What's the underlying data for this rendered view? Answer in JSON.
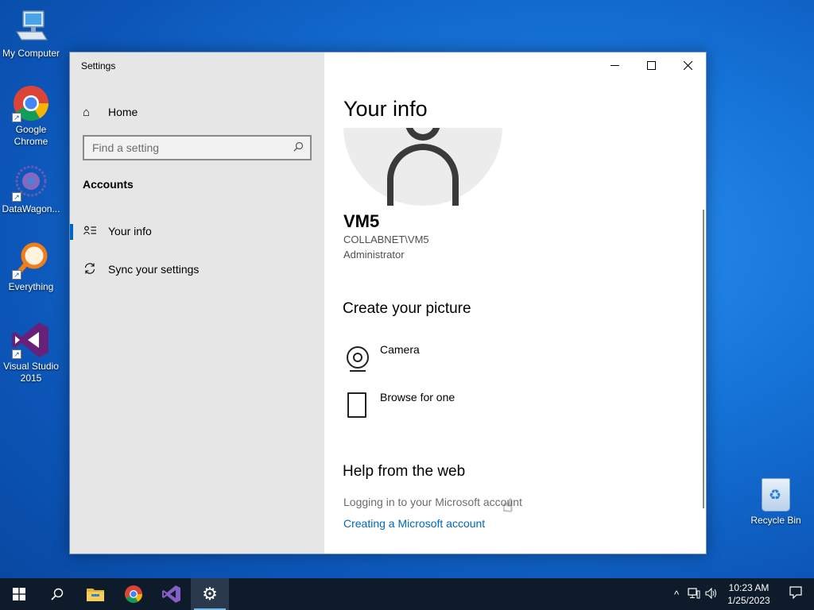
{
  "desktop": {
    "icons": [
      {
        "label": "My Computer",
        "icon": "computer-icon"
      },
      {
        "label": "Google Chrome",
        "icon": "chrome-icon"
      },
      {
        "label": "DataWagon...",
        "icon": "datawagon-icon"
      },
      {
        "label": "Everything",
        "icon": "everything-search-icon"
      },
      {
        "label": "Visual Studio 2015",
        "icon": "visual-studio-icon"
      }
    ],
    "recycle_bin": {
      "label": "Recycle Bin",
      "icon": "recycle-bin-icon"
    }
  },
  "window": {
    "title": "Settings",
    "caption": {
      "minimize": "—",
      "maximize": "☐",
      "close": "✕"
    }
  },
  "nav": {
    "home": {
      "label": "Home",
      "icon": "home-icon"
    },
    "search": {
      "placeholder": "Find a setting",
      "icon": "search-icon"
    },
    "section": "Accounts",
    "items": [
      {
        "label": "Your info",
        "icon": "user-card-icon",
        "active": true
      },
      {
        "label": "Sync your settings",
        "icon": "sync-icon",
        "active": false
      }
    ]
  },
  "content": {
    "title": "Your info",
    "user": {
      "name": "VM5",
      "domain": "COLLABNET\\VM5",
      "role": "Administrator"
    },
    "create_picture": {
      "heading": "Create your picture",
      "options": [
        {
          "label": "Camera",
          "icon": "camera-icon"
        },
        {
          "label": "Browse for one",
          "icon": "file-icon"
        }
      ]
    },
    "help": {
      "heading": "Help from the web",
      "links": [
        {
          "label": "Logging in to your Microsoft account",
          "style": "gray"
        },
        {
          "label": "Creating a Microsoft account",
          "style": "blue"
        }
      ]
    }
  },
  "taskbar": {
    "buttons": [
      "start-icon",
      "search-icon",
      "file-explorer-icon",
      "chrome-icon",
      "visual-studio-icon",
      "settings-gear-icon"
    ],
    "clock": {
      "time": "10:23 AM",
      "date": "1/25/2023"
    }
  },
  "colors": {
    "accent": "#0067c0",
    "nav_bg": "#e6e6e6",
    "taskbar": "#0d1b2a"
  }
}
